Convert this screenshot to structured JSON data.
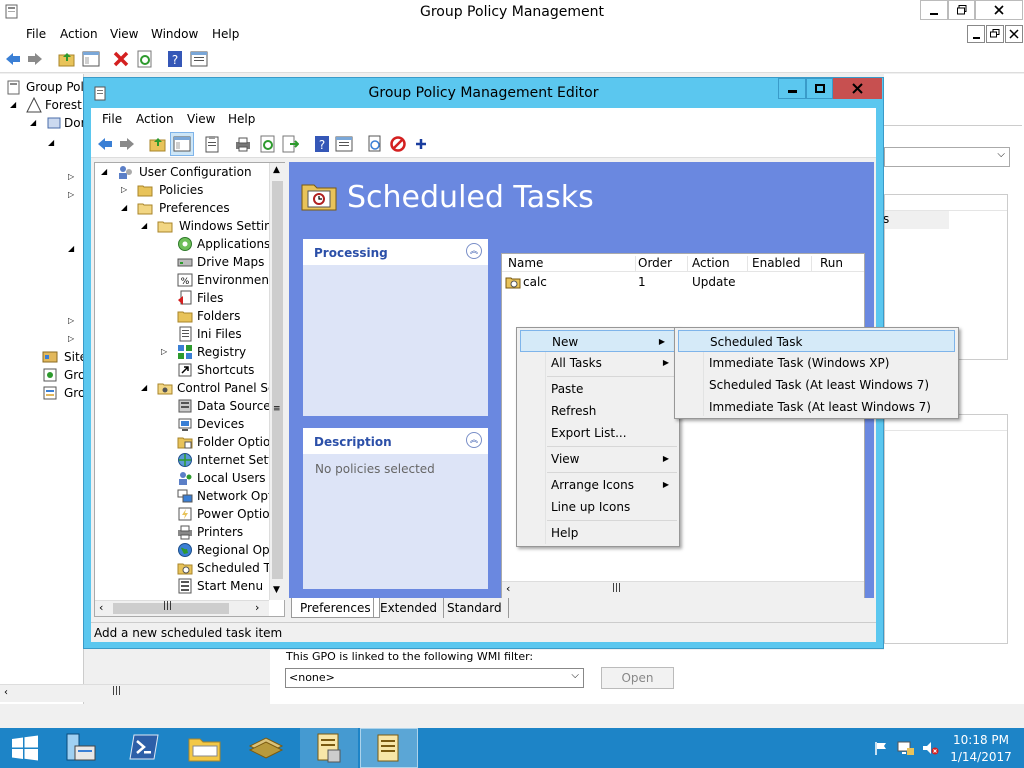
{
  "outer": {
    "title": "Group Policy Management",
    "menu": [
      "File",
      "Action",
      "View",
      "Window",
      "Help"
    ],
    "tree": [
      "Group Poli",
      "Forest:",
      "Dor",
      "Site",
      "Gro",
      "Gro"
    ],
    "wmi_label": "This GPO is linked to the following WMI filter:",
    "wmi_value": "<none>",
    "open_label": "Open",
    "partial_text": "s"
  },
  "editor": {
    "title": "Group Policy Management Editor",
    "menu": [
      "File",
      "Action",
      "View",
      "Help"
    ],
    "status": "Add a new scheduled task item",
    "tree": [
      {
        "label": "User Configuration",
        "icon": "user-config-icon"
      },
      {
        "label": "Policies",
        "icon": "folder-icon"
      },
      {
        "label": "Preferences",
        "icon": "folder-open-icon"
      },
      {
        "label": "Windows Settings",
        "icon": "folder-open-icon"
      },
      {
        "label": "Applications",
        "icon": "applications-icon"
      },
      {
        "label": "Drive Maps",
        "icon": "drive-maps-icon"
      },
      {
        "label": "Environment",
        "icon": "environment-icon"
      },
      {
        "label": "Files",
        "icon": "files-icon"
      },
      {
        "label": "Folders",
        "icon": "folders-icon"
      },
      {
        "label": "Ini Files",
        "icon": "ini-files-icon"
      },
      {
        "label": "Registry",
        "icon": "registry-icon"
      },
      {
        "label": "Shortcuts",
        "icon": "shortcuts-icon"
      },
      {
        "label": "Control Panel Set",
        "icon": "control-panel-icon"
      },
      {
        "label": "Data Sources",
        "icon": "data-sources-icon"
      },
      {
        "label": "Devices",
        "icon": "devices-icon"
      },
      {
        "label": "Folder Option",
        "icon": "folder-options-icon"
      },
      {
        "label": "Internet Settin",
        "icon": "internet-settings-icon"
      },
      {
        "label": "Local Users ar",
        "icon": "local-users-icon"
      },
      {
        "label": "Network Optic",
        "icon": "network-options-icon"
      },
      {
        "label": "Power Option",
        "icon": "power-options-icon"
      },
      {
        "label": "Printers",
        "icon": "printers-icon"
      },
      {
        "label": "Regional Opti",
        "icon": "regional-options-icon"
      },
      {
        "label": "Scheduled Tas",
        "icon": "scheduled-tasks-icon"
      },
      {
        "label": "Start Menu",
        "icon": "start-menu-icon"
      }
    ],
    "heading": "Scheduled Tasks",
    "processing_label": "Processing",
    "description_label": "Description",
    "description_text": "No policies selected",
    "columns": [
      "Name",
      "Order",
      "Action",
      "Enabled",
      "Run"
    ],
    "rows": [
      {
        "name": "calc",
        "order": "1",
        "action": "Update"
      }
    ],
    "tabs": [
      "Preferences",
      "Extended",
      "Standard"
    ]
  },
  "context_menu": {
    "items": [
      "New",
      "All Tasks",
      "Paste",
      "Refresh",
      "Export List...",
      "View",
      "Arrange Icons",
      "Line up Icons",
      "Help"
    ]
  },
  "submenu": {
    "items": [
      "Scheduled Task",
      "Immediate Task (Windows XP)",
      "Scheduled Task (At least Windows 7)",
      "Immediate Task (At least Windows 7)"
    ]
  },
  "taskbar": {
    "time": "10:18 PM",
    "date": "1/14/2017"
  },
  "colors": {
    "title_blue": "#5bc7ef",
    "panel_blue": "#6a88e0",
    "taskbar_blue": "#1d84c7",
    "close_red": "#c75050",
    "highlight": "#d5eaf8"
  }
}
